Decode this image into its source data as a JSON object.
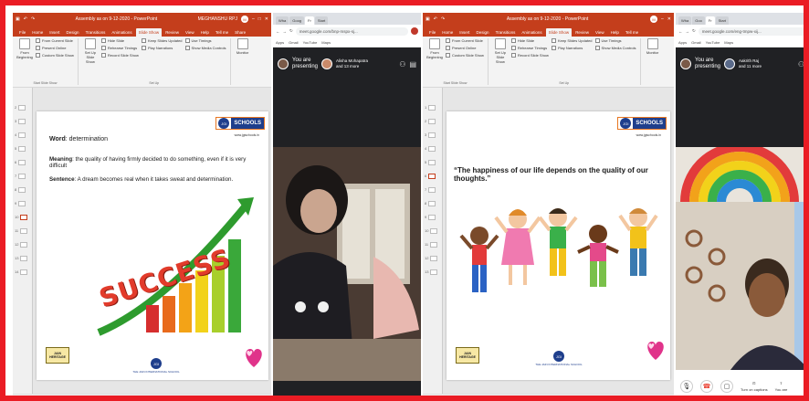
{
  "colors": {
    "frame": "#ea1c24",
    "ppt_red": "#c43e1c",
    "meet_dark": "#202124",
    "jis_blue": "#1e3e8c",
    "jis_orange": "#e87722"
  },
  "ppt": {
    "title_doc": "Assembly as on 9-12-2020 - PowerPoint",
    "user": "MEGHANSHU RPJ",
    "user_initial": "M",
    "tabs": [
      "File",
      "Home",
      "Insert",
      "Design",
      "Transitions",
      "Animations",
      "Slide Show",
      "Review",
      "View",
      "Help",
      "Tell me"
    ],
    "share": "Share",
    "ribbon": {
      "from_beginning": "From Beginning",
      "from_current": "From Current Slide",
      "present_online": "Present Online",
      "custom_show": "Custom Slide Show",
      "group_start": "Start Slide Show",
      "setup_show": "Set Up Slide Show",
      "hide_slide": "Hide Slide",
      "rehearse": "Rehearse Timings",
      "record": "Record Slide Show",
      "keep_updated": "Keep Slides Updated",
      "play_narrations": "Play Narrations",
      "use_timings": "Use Timings",
      "show_media": "Show Media Controls",
      "group_setup": "Set Up",
      "monitor": "Monitor"
    },
    "thumb_numbers": [
      "1",
      "2",
      "3",
      "4",
      "5",
      "6",
      "7",
      "8",
      "9",
      "10",
      "11",
      "12",
      "13",
      "14"
    ],
    "status_left": "Slide 6 of 14",
    "status_lang": "English (India)"
  },
  "slide1": {
    "word_label": "Word",
    "word_value": ": determination",
    "meaning_label": "Meaning",
    "meaning_value": ": the quality of having firmly decided to do something, even if it is very difficult",
    "sentence_label": "Sentence",
    "sentence_value": ": A dream becomes real when it takes sweat and determination.",
    "success_word": "SUCCESS"
  },
  "logo": {
    "jis_mark": "JGI",
    "jis_text": "SCHOOLS",
    "jis_url": "www.jgischools.in",
    "jain_line1": "JAIN",
    "jain_line2": "HERITAGE",
    "school_mark": "JGI",
    "school_name": "THE JAIN INTERNATIONAL SCHOOL"
  },
  "slide2": {
    "quote": "“The happiness of our life depends on the quality of our thoughts.”"
  },
  "meet1": {
    "tabs": [
      "Wha",
      "Goog",
      "Fr",
      "Start"
    ],
    "url": "meet.google.com/bnp-mspx-sj...",
    "bookmarks": [
      "Apps",
      "Gmail",
      "YouTube",
      "Maps"
    ],
    "present_line1": "You are",
    "present_line2": "presenting",
    "who_line1": "Alisha Mohapatra",
    "who_line2": "and 13 more"
  },
  "meet2": {
    "tabs": [
      "Wha",
      "Goo",
      "Fr",
      "Start"
    ],
    "url": "meet.google.com/eng-tmpw-xij...",
    "bookmarks": [
      "Apps",
      "Gmail",
      "YouTube",
      "Maps"
    ],
    "present_line1": "You are",
    "present_line2": "presenting",
    "who_line1": "Aakrith Raj",
    "who_line2": "and 11 more",
    "captions": "Turn on captions",
    "you_are": "You are"
  }
}
